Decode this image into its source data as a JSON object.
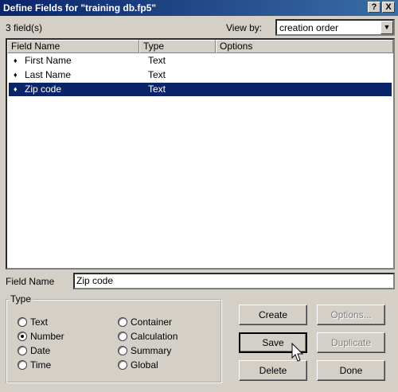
{
  "window": {
    "title": "Define Fields for \"training db.fp5\"",
    "help_btn": "?",
    "close_btn": "X"
  },
  "summary": {
    "field_count": "3 field(s)",
    "view_by_label": "View by:",
    "view_by_value": "creation order"
  },
  "list": {
    "columns": [
      "Field Name",
      "Type",
      "Options"
    ],
    "rows": [
      {
        "name": "First Name",
        "type": "Text",
        "options": ""
      },
      {
        "name": "Last Name",
        "type": "Text",
        "options": ""
      },
      {
        "name": "Zip code",
        "type": "Text",
        "options": ""
      }
    ],
    "selected_index": 2,
    "bullet": "♦"
  },
  "field_name": {
    "label": "Field Name",
    "value": "Zip code"
  },
  "type_group": {
    "legend": "Type",
    "options": [
      "Text",
      "Number",
      "Date",
      "Time",
      "Container",
      "Calculation",
      "Summary",
      "Global"
    ],
    "selected": "Number"
  },
  "buttons": {
    "create": "Create",
    "options": "Options...",
    "save": "Save",
    "duplicate": "Duplicate",
    "delete": "Delete",
    "done": "Done"
  },
  "colors": {
    "selection": "#0a246a",
    "title_start": "#0a246a",
    "title_end": "#3a6ea5",
    "face": "#d4d0c8"
  }
}
